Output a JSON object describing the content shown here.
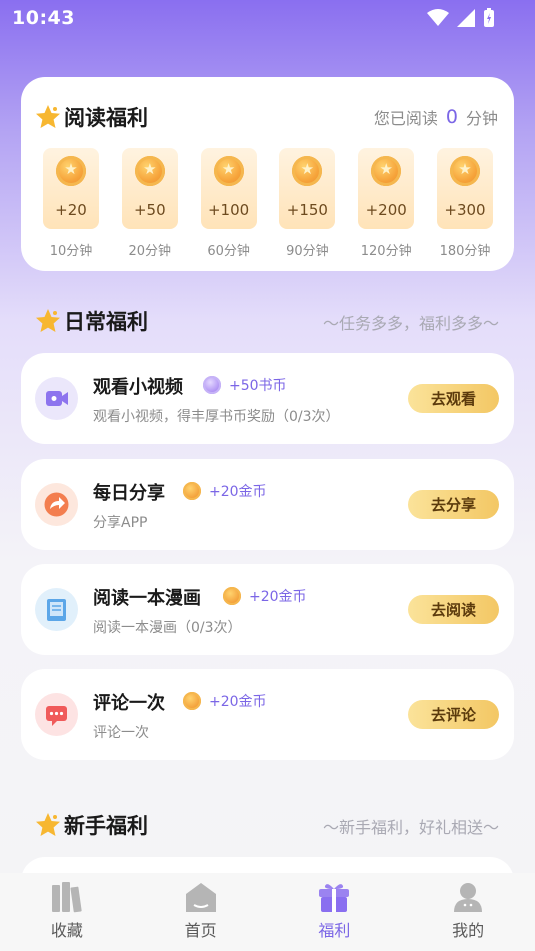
{
  "status_bar": {
    "time": "10:43"
  },
  "reading_welfare": {
    "title": "阅读福利",
    "progress_prefix": "您已阅读",
    "progress_value": "0",
    "progress_unit": "分钟",
    "rewards": [
      {
        "amount": "+20",
        "time": "10分钟"
      },
      {
        "amount": "+50",
        "time": "20分钟"
      },
      {
        "amount": "+100",
        "time": "60分钟"
      },
      {
        "amount": "+150",
        "time": "90分钟"
      },
      {
        "amount": "+200",
        "time": "120分钟"
      },
      {
        "amount": "+300",
        "time": "180分钟"
      }
    ]
  },
  "daily_welfare": {
    "title": "日常福利",
    "subtitle": "～任务多多，福利多多～",
    "tasks": [
      {
        "title": "观看小视频",
        "reward": "+50书币",
        "desc": "观看小视频，得丰厚书币奖励（0/3次）",
        "button": "去观看",
        "icon": "video-icon",
        "icon_bg": "#ebe7fb",
        "icon_color": "#8d74ee"
      },
      {
        "title": "每日分享",
        "reward": "+20金币",
        "desc": "分享APP",
        "button": "去分享",
        "icon": "share-icon",
        "icon_bg": "#fde7dd",
        "icon_color": "#f37e4f"
      },
      {
        "title": "阅读一本漫画",
        "reward": "+20金币",
        "desc": "阅读一本漫画（0/3次）",
        "button": "去阅读",
        "icon": "book-icon",
        "icon_bg": "#e1f0fb",
        "icon_color": "#5ba6e8"
      },
      {
        "title": "评论一次",
        "reward": "+20金币",
        "desc": "评论一次",
        "button": "去评论",
        "icon": "comment-icon",
        "icon_bg": "#fde3e3",
        "icon_color": "#f05a5a"
      }
    ]
  },
  "newbie_welfare": {
    "title": "新手福利",
    "subtitle": "～新手福利，好礼相送～"
  },
  "tab_bar": {
    "tabs": [
      {
        "label": "收藏",
        "icon": "bookshelf-icon"
      },
      {
        "label": "首页",
        "icon": "home-icon"
      },
      {
        "label": "福利",
        "icon": "gift-icon",
        "active": true
      },
      {
        "label": "我的",
        "icon": "profile-icon"
      }
    ]
  },
  "colors": {
    "accent": "#7b66e6",
    "button": "#f3c764"
  }
}
